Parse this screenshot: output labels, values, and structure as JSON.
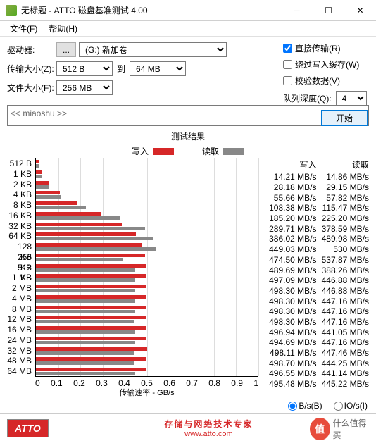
{
  "window": {
    "title": "无标题 - ATTO 磁盘基准测试 4.00"
  },
  "menu": {
    "file": "文件(F)",
    "help": "帮助(H)"
  },
  "form": {
    "drive_lbl": "驱动器:",
    "browse": "...",
    "drive_val": "(G:) 新加卷",
    "xfer_lbl": "传输大小(Z):",
    "xfer_from": "512 B",
    "to": "到",
    "xfer_to": "64 MB",
    "file_lbl": "文件大小(F):",
    "file_val": "256 MB"
  },
  "opts": {
    "direct": "直接传输(R)",
    "bypass": "绕过写入缓存(W)",
    "verify": "校验数据(V)",
    "qd_lbl": "队列深度(Q):",
    "qd_val": "4",
    "start": "开始"
  },
  "desc": "<< miaoshu >>",
  "res": {
    "title": "测试结果",
    "write": "写入",
    "read": "读取",
    "xlabel": "传输速率 - GB/s"
  },
  "unit": {
    "bps": "B/s(B)",
    "iops": "IO/s(I)"
  },
  "footer": {
    "logo": "ATTO",
    "slogan": "存储与网络技术专家",
    "url": "www.atto.com"
  },
  "watermark": {
    "char": "值",
    "text": "什么值得买"
  },
  "xticks": [
    "0",
    "0.1",
    "0.2",
    "0.3",
    "0.4",
    "0.5",
    "0.6",
    "0.7",
    "0.8",
    "0.9",
    "1"
  ],
  "chart_data": {
    "type": "bar",
    "xlabel": "传输速率 - GB/s",
    "xlim": [
      0,
      1
    ],
    "unit": "MB/s",
    "series": [
      {
        "name": "写入"
      },
      {
        "name": "读取"
      }
    ],
    "rows": [
      {
        "label": "512 B",
        "write": 14.21,
        "read": 14.86
      },
      {
        "label": "1 KB",
        "write": 28.18,
        "read": 29.15
      },
      {
        "label": "2 KB",
        "write": 55.66,
        "read": 57.82
      },
      {
        "label": "4 KB",
        "write": 108.38,
        "read": 115.47
      },
      {
        "label": "8 KB",
        "write": 185.2,
        "read": 225.2
      },
      {
        "label": "16 KB",
        "write": 289.71,
        "read": 378.59
      },
      {
        "label": "32 KB",
        "write": 386.02,
        "read": 489.98
      },
      {
        "label": "64 KB",
        "write": 449.03,
        "read": 530
      },
      {
        "label": "128 KB",
        "write": 474.5,
        "read": 537.87
      },
      {
        "label": "256 KB",
        "write": 489.69,
        "read": 388.26
      },
      {
        "label": "512 KB",
        "write": 497.09,
        "read": 446.88
      },
      {
        "label": "1 MB",
        "write": 498.3,
        "read": 446.88
      },
      {
        "label": "2 MB",
        "write": 498.3,
        "read": 447.16
      },
      {
        "label": "4 MB",
        "write": 498.3,
        "read": 447.16
      },
      {
        "label": "8 MB",
        "write": 498.3,
        "read": 447.16
      },
      {
        "label": "12 MB",
        "write": 496.94,
        "read": 441.05
      },
      {
        "label": "16 MB",
        "write": 494.69,
        "read": 447.16
      },
      {
        "label": "24 MB",
        "write": 498.11,
        "read": 447.46
      },
      {
        "label": "32 MB",
        "write": 498.7,
        "read": 444.25
      },
      {
        "label": "48 MB",
        "write": 496.55,
        "read": 441.14
      },
      {
        "label": "64 MB",
        "write": 495.48,
        "read": 445.22
      }
    ]
  }
}
